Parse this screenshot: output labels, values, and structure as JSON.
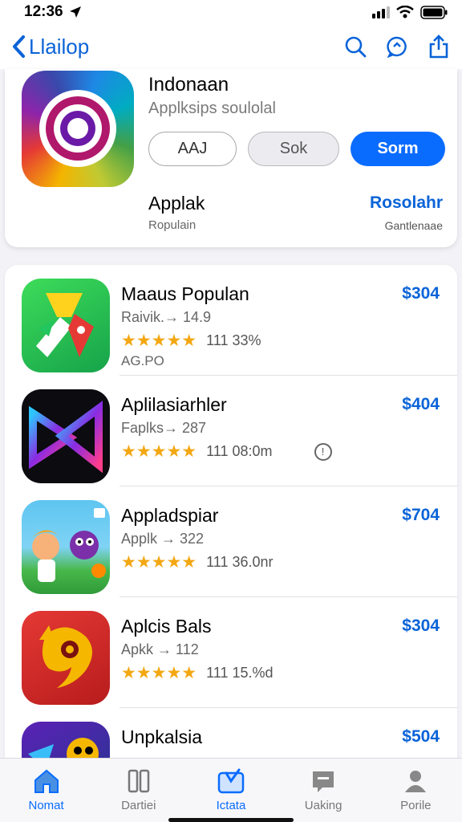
{
  "status": {
    "time": "12:36"
  },
  "nav": {
    "back_label": "Llailop"
  },
  "hero": {
    "title": "Indonaan",
    "subtitle": "Applksips soulolal",
    "buttons": [
      "AAJ",
      "Sok",
      "Sorm"
    ],
    "section_title": "Applak",
    "section_caption": "Ropulain",
    "link": "Rosolahr",
    "link_caption": "Gantlenaae"
  },
  "apps": [
    {
      "name": "Maaus Populan",
      "meta": "Raivik.→ 14.9",
      "stars": "★★★★★",
      "rating": "111  33%",
      "extra": "AG.PO",
      "price": "$304"
    },
    {
      "name": "Aplilasiarhler",
      "meta": "Faplks→ 287",
      "stars": "★★★★★",
      "rating": "111  08:0m",
      "price": "$404"
    },
    {
      "name": "Appladspiar",
      "meta": "Applk → 322",
      "stars": "★★★★★",
      "rating": "111  36.0nr",
      "price": "$704"
    },
    {
      "name": "Aplcis Bals",
      "meta": "Apkk → 112",
      "stars": "★★★★★",
      "rating": "111  15.%d",
      "price": "$304"
    },
    {
      "name": "Unpkalsia",
      "price": "$504"
    }
  ],
  "tabs": [
    {
      "label": "Nomat",
      "icon": "home-icon"
    },
    {
      "label": "Dartiei",
      "icon": "book-icon"
    },
    {
      "label": "Ictata",
      "icon": "apps-icon"
    },
    {
      "label": "Uaking",
      "icon": "chat-icon"
    },
    {
      "label": "Porile",
      "icon": "person-icon"
    }
  ],
  "colors": {
    "accent": "#0a6cff",
    "link": "#0a63d8",
    "star": "#f3a712"
  }
}
